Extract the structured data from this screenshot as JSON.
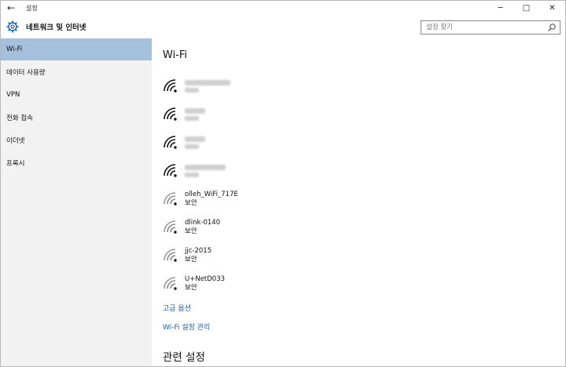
{
  "window": {
    "title": "설정"
  },
  "titlebar": {
    "back_icon": "←",
    "min_icon": "─",
    "max_icon": "□",
    "close_icon": "✕"
  },
  "header": {
    "title": "네트워크 및 인터넷",
    "search_placeholder": "설정 찾기"
  },
  "sidebar": {
    "items": [
      {
        "label": "Wi-Fi",
        "active": true
      },
      {
        "label": "데이터 사용량",
        "active": false
      },
      {
        "label": "VPN",
        "active": false
      },
      {
        "label": "전화 접속",
        "active": false
      },
      {
        "label": "이더넷",
        "active": false
      },
      {
        "label": "프록시",
        "active": false
      }
    ]
  },
  "main": {
    "title": "Wi-Fi",
    "networks": [
      {
        "name": "",
        "status": "",
        "blurred": true,
        "signal": "strong"
      },
      {
        "name": "",
        "status": "",
        "blurred": true,
        "signal": "strong"
      },
      {
        "name": "",
        "status": "",
        "blurred": true,
        "signal": "strong"
      },
      {
        "name": "",
        "status": "",
        "blurred": true,
        "signal": "strong"
      },
      {
        "name": "olleh_WiFi_717E",
        "status": "보안",
        "blurred": false,
        "signal": "weak"
      },
      {
        "name": "dlink-0140",
        "status": "보안",
        "blurred": false,
        "signal": "weak"
      },
      {
        "name": "jjc-2015",
        "status": "보안",
        "blurred": false,
        "signal": "weak"
      },
      {
        "name": "U+NetD033",
        "status": "보안",
        "blurred": false,
        "signal": "weak"
      }
    ],
    "advanced_options": "고급 옵션",
    "manage_wifi": "Wi-Fi 설정 관리",
    "related_settings": "관련 설정"
  },
  "colors": {
    "sidebar_bg": "#f2f2f2",
    "active_bg": "#a4c0dd",
    "link": "#1a5fb4"
  }
}
